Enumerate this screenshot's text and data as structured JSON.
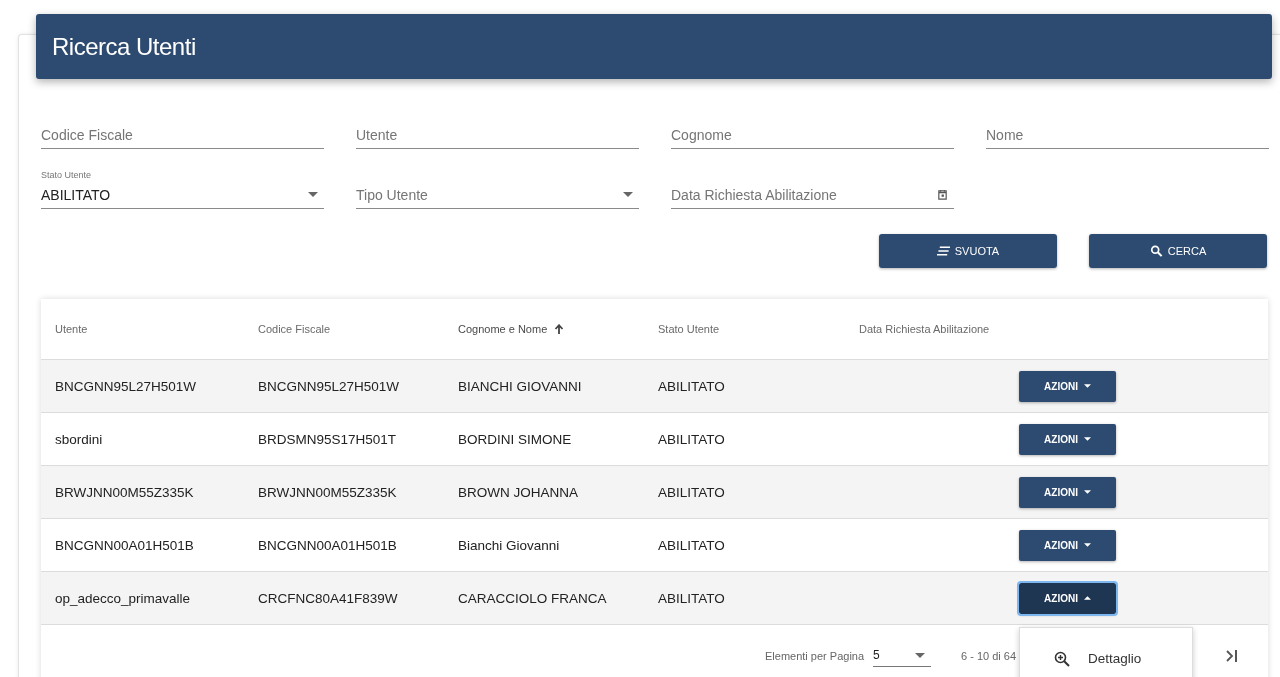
{
  "page_title": "Ricerca Utenti",
  "filters": [
    {
      "kind": "text",
      "placeholder": "Codice Fiscale"
    },
    {
      "kind": "text",
      "placeholder": "Utente"
    },
    {
      "kind": "text",
      "placeholder": "Cognome"
    },
    {
      "kind": "text",
      "placeholder": "Nome"
    },
    {
      "kind": "select",
      "label": "Stato Utente",
      "value": "ABILITATO"
    },
    {
      "kind": "select",
      "placeholder": "Tipo Utente"
    },
    {
      "kind": "date",
      "placeholder": "Data Richiesta Abilitazione"
    }
  ],
  "buttons": [
    {
      "kind": "clear",
      "label": "SVUOTA"
    },
    {
      "kind": "search",
      "label": "CERCA"
    }
  ],
  "table": {
    "columns": [
      {
        "label": "Utente",
        "sorted": false
      },
      {
        "label": "Codice Fiscale",
        "sorted": false
      },
      {
        "label": "Cognome e Nome",
        "sorted": true
      },
      {
        "label": "Stato Utente",
        "sorted": false
      },
      {
        "label": "Data Richiesta Abilitazione",
        "sorted": false
      }
    ],
    "rows": [
      {
        "cells": [
          "BNCGNN95L27H501W",
          "BNCGNN95L27H501W",
          "BIANCHI GIOVANNI",
          "ABILITATO"
        ],
        "action": "AZIONI",
        "expanded": false
      },
      {
        "cells": [
          "sbordini",
          "BRDSMN95S17H501T",
          "BORDINI SIMONE",
          "ABILITATO"
        ],
        "action": "AZIONI",
        "expanded": false
      },
      {
        "cells": [
          "BRWJNN00M55Z335K",
          "BRWJNN00M55Z335K",
          "BROWN JOHANNA",
          "ABILITATO"
        ],
        "action": "AZIONI",
        "expanded": false
      },
      {
        "cells": [
          "BNCGNN00A01H501B",
          "BNCGNN00A01H501B",
          "Bianchi Giovanni",
          "ABILITATO"
        ],
        "action": "AZIONI",
        "expanded": false
      },
      {
        "cells": [
          "op_adecco_primavalle",
          "CRCFNC80A41F839W",
          "CARACCIOLO FRANCA",
          "ABILITATO"
        ],
        "action": "AZIONI",
        "expanded": true
      }
    ]
  },
  "menu": {
    "items": [
      "Dettaglio"
    ]
  },
  "paginator": {
    "label": "Elementi per Pagina",
    "page_size": "5",
    "range": "6 - 10 di 64"
  }
}
